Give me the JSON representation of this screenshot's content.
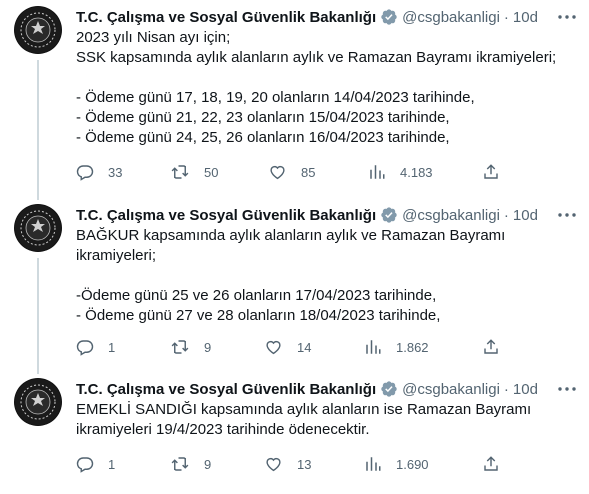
{
  "tweets": [
    {
      "name": "T.C. Çalışma ve Sosyal Güvenlik Bakanlığı",
      "handle": "@csgbakanligi",
      "dot": "·",
      "time": "10d",
      "text": "2023 yılı Nisan ayı için;\nSSK kapsamında aylık alanların aylık ve Ramazan Bayramı ikramiyeleri;\n\n- Ödeme günü 17, 18, 19, 20 olanların 14/04/2023 tarihinde,\n- Ödeme günü 21, 22, 23 olanların 15/04/2023 tarihinde,\n- Ödeme günü 24, 25, 26 olanların 16/04/2023 tarihinde,",
      "replies": "33",
      "retweets": "50",
      "likes": "85",
      "views": "4.183"
    },
    {
      "name": "T.C. Çalışma ve Sosyal Güvenlik Bakanlığı",
      "handle": "@csgbakanligi",
      "dot": "·",
      "time": "10d",
      "text": "BAĞKUR kapsamında aylık alanların aylık ve Ramazan Bayramı\nikramiyeleri;\n\n-Ödeme günü 25 ve 26 olanların 17/04/2023 tarihinde,\n- Ödeme günü 27 ve 28 olanların 18/04/2023 tarihinde,",
      "replies": "1",
      "retweets": "9",
      "likes": "14",
      "views": "1.862"
    },
    {
      "name": "T.C. Çalışma ve Sosyal Güvenlik Bakanlığı",
      "handle": "@csgbakanligi",
      "dot": "·",
      "time": "10d",
      "text": "EMEKLİ SANDIĞI kapsamında aylık alanların ise Ramazan Bayramı\nikramiyeleri 19/4/2023 tarihinde ödenecektir.",
      "replies": "1",
      "retweets": "9",
      "likes": "13",
      "views": "1.690"
    }
  ],
  "icons": {
    "verified": "verified-badge-icon",
    "more": "more-icon",
    "reply": "reply-icon",
    "retweet": "retweet-icon",
    "like": "heart-icon",
    "views": "views-icon",
    "share": "share-icon"
  },
  "colors": {
    "text": "#0f1419",
    "muted": "#536471",
    "verified": "#829aab",
    "thread_line": "#cfd9de"
  }
}
